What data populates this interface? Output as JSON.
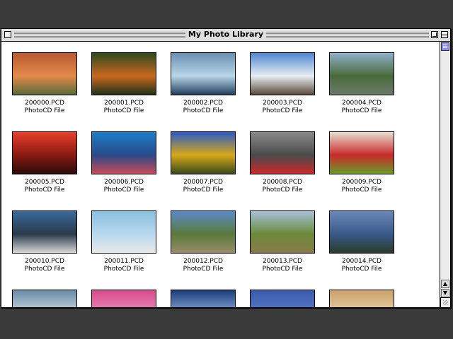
{
  "window": {
    "title": "My Photo Library"
  },
  "items": [
    {
      "name": "200000.PCD",
      "type": "PhotoCD File",
      "colors": [
        "#b85a32",
        "#e28a4a",
        "#5a6a3a"
      ],
      "subject": "stonehenge-sunset"
    },
    {
      "name": "200001.PCD",
      "type": "PhotoCD File",
      "colors": [
        "#2e4a1e",
        "#c8681e",
        "#223218"
      ],
      "subject": "tiger"
    },
    {
      "name": "200002.PCD",
      "type": "PhotoCD File",
      "colors": [
        "#6a8fb0",
        "#b8d6e8",
        "#22405e"
      ],
      "subject": "iceberg"
    },
    {
      "name": "200003.PCD",
      "type": "PhotoCD File",
      "colors": [
        "#4f86d0",
        "#e8eef4",
        "#5a4a3a"
      ],
      "subject": "mountain-climber"
    },
    {
      "name": "200004.PCD",
      "type": "PhotoCD File",
      "colors": [
        "#8fb0cc",
        "#4a6a3a",
        "#6a7a6a"
      ],
      "subject": "bridge"
    },
    {
      "name": "200005.PCD",
      "type": "PhotoCD File",
      "colors": [
        "#e8402a",
        "#8a1a14",
        "#2a0a0a"
      ],
      "subject": "sunset-forest"
    },
    {
      "name": "200006.PCD",
      "type": "PhotoCD File",
      "colors": [
        "#1a7ec8",
        "#2a4a8a",
        "#c84a5a"
      ],
      "subject": "diver-reef"
    },
    {
      "name": "200007.PCD",
      "type": "PhotoCD File",
      "colors": [
        "#2a5ac8",
        "#d8a81a",
        "#3a4a1a"
      ],
      "subject": "autumn-tree"
    },
    {
      "name": "200008.PCD",
      "type": "PhotoCD File",
      "colors": [
        "#8a8a8a",
        "#4a4a4a",
        "#c82a2a"
      ],
      "subject": "race-car"
    },
    {
      "name": "200009.PCD",
      "type": "PhotoCD File",
      "colors": [
        "#e8e0d0",
        "#c82a2a",
        "#6a9a2a"
      ],
      "subject": "fruit"
    },
    {
      "name": "200010.PCD",
      "type": "PhotoCD File",
      "colors": [
        "#3a6a9a",
        "#2a3a4a",
        "#d8d8d8"
      ],
      "subject": "sea-rocks"
    },
    {
      "name": "200011.PCD",
      "type": "PhotoCD File",
      "colors": [
        "#8ac0e0",
        "#b8d8ee",
        "#e8e8e8"
      ],
      "subject": "jet-plane"
    },
    {
      "name": "200012.PCD",
      "type": "PhotoCD File",
      "colors": [
        "#5a8ac8",
        "#5a7a3a",
        "#9a8a6a"
      ],
      "subject": "great-wall"
    },
    {
      "name": "200013.PCD",
      "type": "PhotoCD File",
      "colors": [
        "#a8c0d8",
        "#6a8a3a",
        "#8a7a4a"
      ],
      "subject": "countryside"
    },
    {
      "name": "200014.PCD",
      "type": "PhotoCD File",
      "colors": [
        "#6a88b8",
        "#3a5a8a",
        "#2a3a2a"
      ],
      "subject": "lake-mountains"
    },
    {
      "name": "",
      "type": "",
      "colors": [
        "#6a8aa8",
        "#c8d8e0",
        "#9ab0c0"
      ],
      "subject": "partial-1"
    },
    {
      "name": "",
      "type": "",
      "colors": [
        "#d84a8a",
        "#e88ab8",
        "#4a7a2a"
      ],
      "subject": "partial-2"
    },
    {
      "name": "",
      "type": "",
      "colors": [
        "#1a3a7a",
        "#8aaada",
        "#e8eef8"
      ],
      "subject": "partial-3"
    },
    {
      "name": "",
      "type": "",
      "colors": [
        "#3a5aaa",
        "#5a7ac8",
        "#8aa0d8"
      ],
      "subject": "partial-4"
    },
    {
      "name": "",
      "type": "",
      "colors": [
        "#c8a06a",
        "#e8d0a8",
        "#8a6a3a"
      ],
      "subject": "partial-5"
    }
  ]
}
